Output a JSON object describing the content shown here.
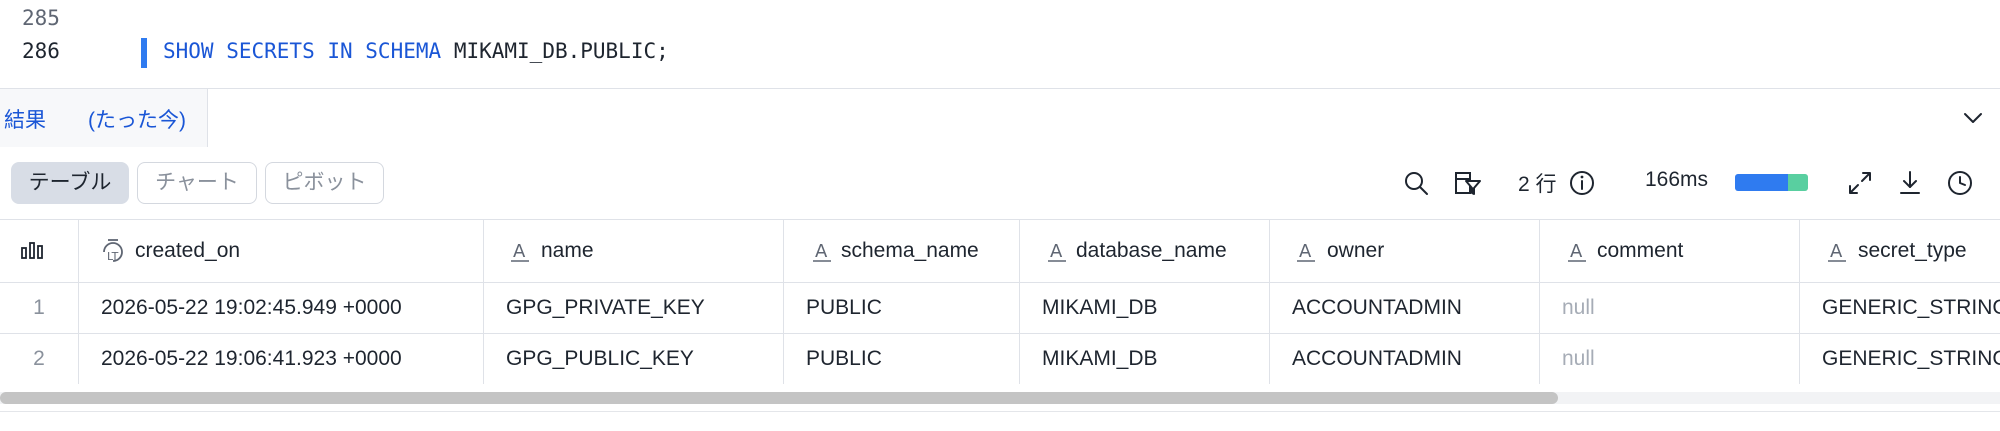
{
  "editor": {
    "lines": [
      {
        "number": "285",
        "text": ""
      },
      {
        "number": "286",
        "keywords": "SHOW SECRETS IN SCHEMA",
        "identifier": "MIKAMI_DB.PUBLIC;"
      }
    ]
  },
  "result_tab": {
    "label": "結果",
    "time": "(たった今)"
  },
  "toolbar": {
    "views": [
      "テーブル",
      "チャート",
      "ピボット"
    ],
    "active_view": "テーブル",
    "row_count": "2 行",
    "duration": "166ms",
    "timing_bar": {
      "blue_fraction": 0.73,
      "green_fraction": 0.27
    },
    "icons": [
      "search-icon",
      "column-filter-icon",
      "info-icon",
      "expand-icon",
      "download-icon",
      "history-icon"
    ]
  },
  "grid": {
    "columns": [
      {
        "name": "",
        "type_icon": "column-stats-icon"
      },
      {
        "name": "created_on",
        "type_icon": "timestamp-type-icon"
      },
      {
        "name": "name",
        "type_icon": "text-type-icon"
      },
      {
        "name": "schema_name",
        "type_icon": "text-type-icon"
      },
      {
        "name": "database_name",
        "type_icon": "text-type-icon"
      },
      {
        "name": "owner",
        "type_icon": "text-type-icon"
      },
      {
        "name": "comment",
        "type_icon": "text-type-icon"
      },
      {
        "name": "secret_type",
        "type_icon": "text-type-icon"
      }
    ],
    "rows": [
      [
        "1",
        "2026-05-22 19:02:45.949 +0000",
        "GPG_PRIVATE_KEY",
        "PUBLIC",
        "MIKAMI_DB",
        "ACCOUNTADMIN",
        "null",
        "GENERIC_STRING"
      ],
      [
        "2",
        "2026-05-22 19:06:41.923 +0000",
        "GPG_PUBLIC_KEY",
        "PUBLIC",
        "MIKAMI_DB",
        "ACCOUNTADMIN",
        "null",
        "GENERIC_STRING"
      ]
    ]
  },
  "colors": {
    "accent": "#2f7bf0",
    "keyword": "#1a56d6",
    "timing_blue": "#2f7bf0",
    "timing_green": "#59cfa0"
  }
}
